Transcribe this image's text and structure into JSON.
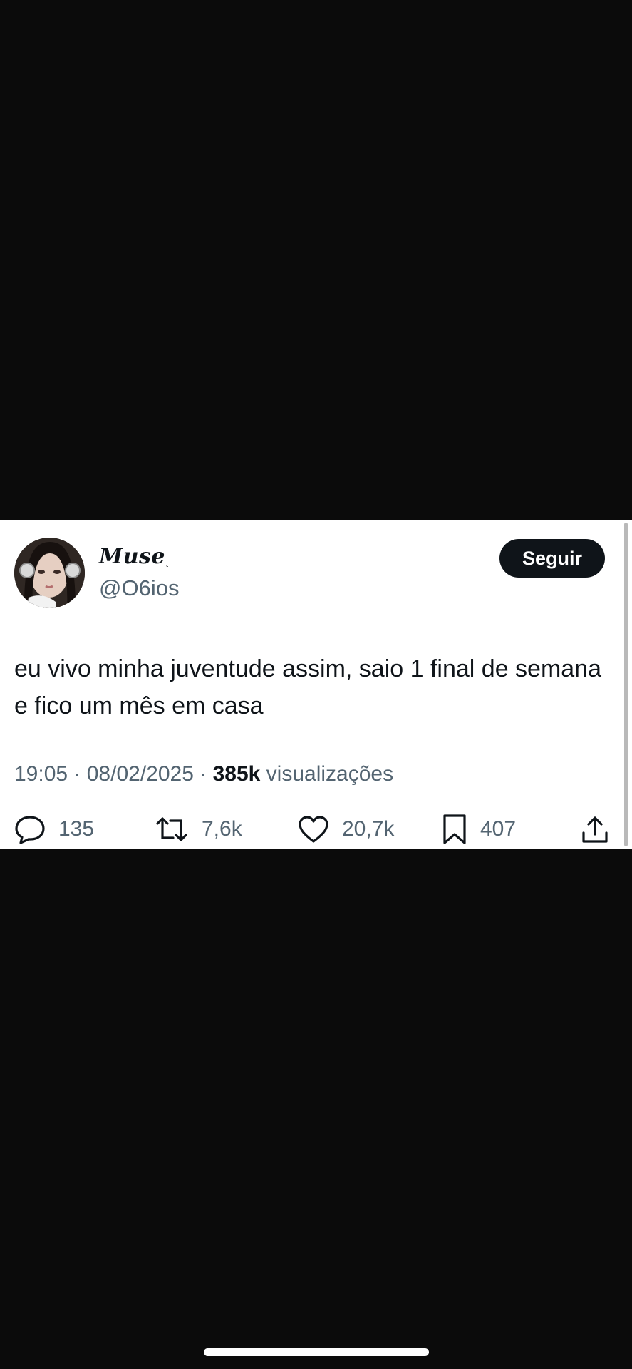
{
  "tweet": {
    "display_name": "Muse",
    "name_mark": "˛",
    "handle": "@O6ios",
    "follow_label": "Seguir",
    "text": "eu vivo minha juventude assim, saio 1 final de semana e fico um mês em casa",
    "time": "19:05",
    "separator": " · ",
    "date": "08/02/2025",
    "views_count": "385k",
    "views_label": "visualizações"
  },
  "actions": {
    "replies": "135",
    "reposts": "7,6k",
    "likes": "20,7k",
    "bookmarks": "407"
  },
  "icons": {
    "reply": "reply-icon",
    "repost": "repost-icon",
    "like": "heart-icon",
    "bookmark": "bookmark-icon",
    "share": "share-icon"
  },
  "colors": {
    "background": "#0b0b0b",
    "card": "#ffffff",
    "text_primary": "#0f1419",
    "text_secondary": "#536471",
    "button": "#0f1419"
  }
}
